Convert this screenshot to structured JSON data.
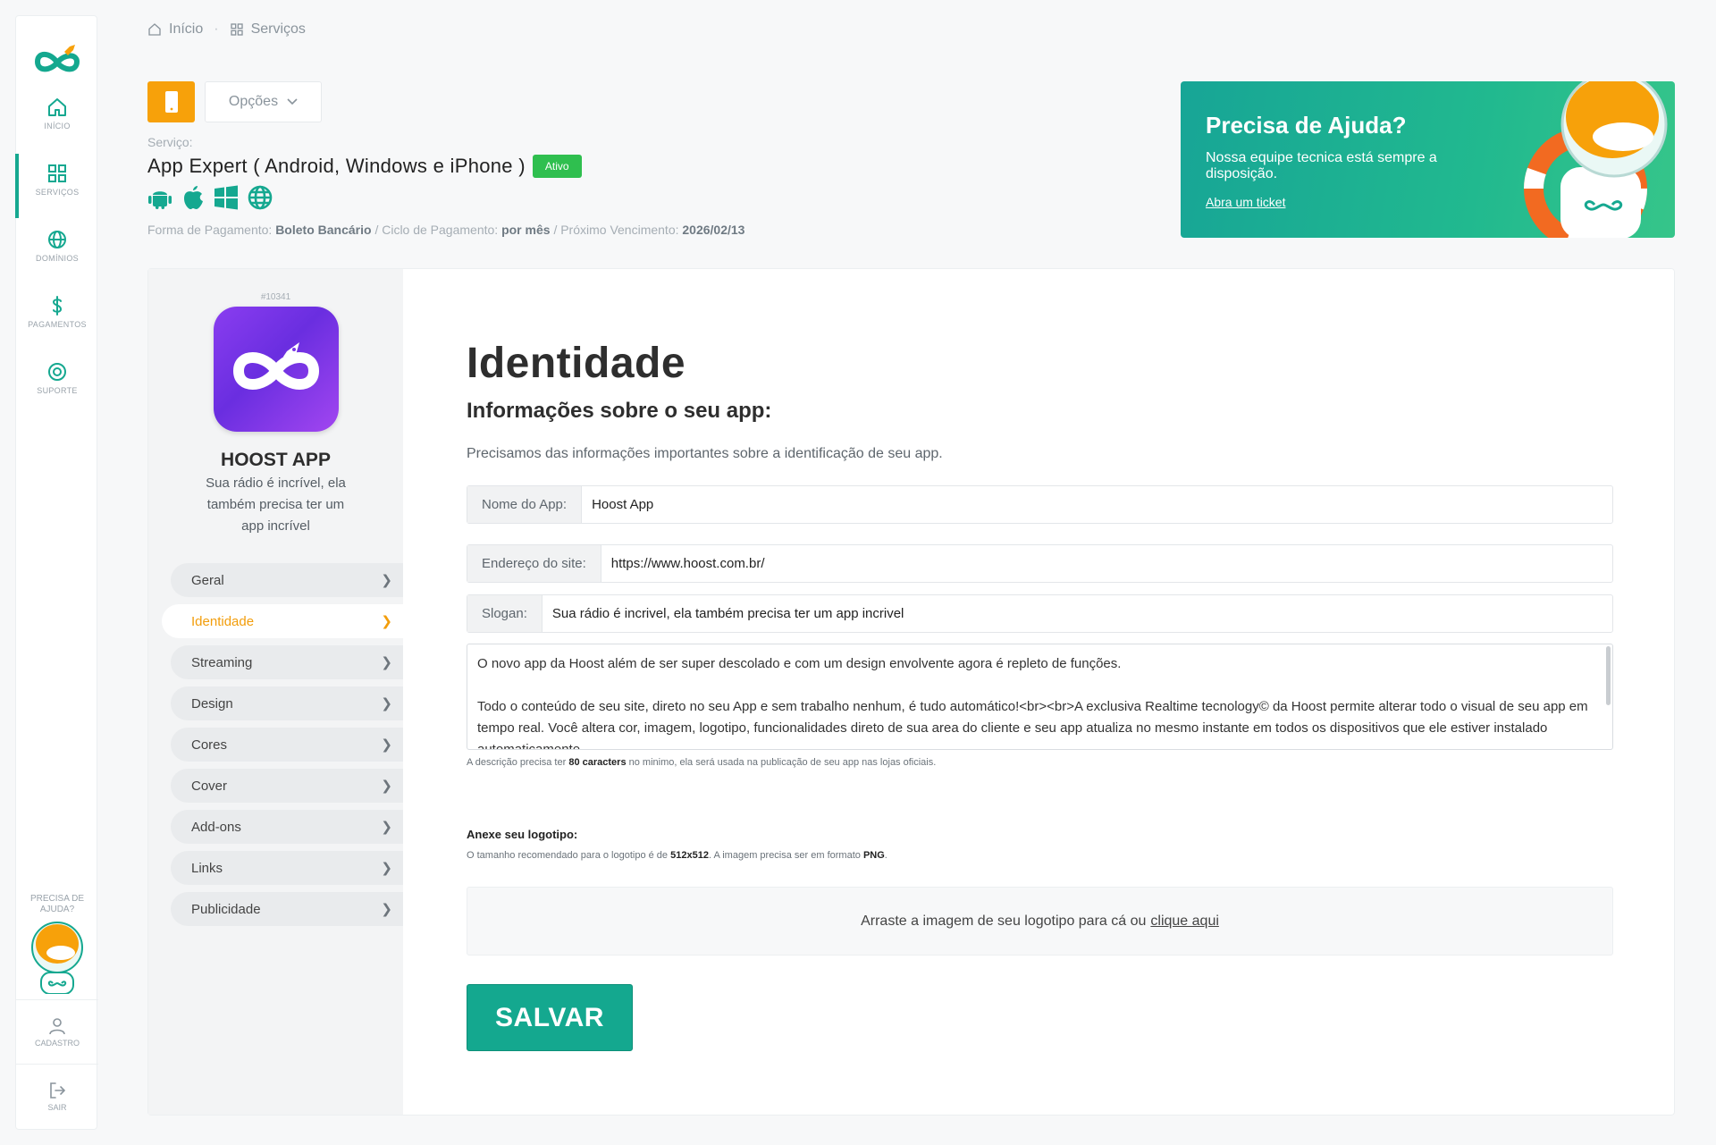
{
  "sidebar": {
    "items": [
      {
        "label": "Início",
        "icon": "home-icon"
      },
      {
        "label": "Serviços",
        "icon": "grid-icon"
      },
      {
        "label": "Domínios",
        "icon": "globe-icon"
      },
      {
        "label": "Pagamentos",
        "icon": "dollar-icon"
      },
      {
        "label": "Suporte",
        "icon": "lifebuoy-icon"
      }
    ],
    "help_label": "Precisa de ajuda?",
    "profile_label": "Cadastro",
    "logout_label": "Sair"
  },
  "breadcrumb": {
    "home": "Início",
    "current": "Serviços"
  },
  "header": {
    "options_label": "Opções",
    "service_label": "Serviço:",
    "service_title": "App Expert ( Android, Windows e iPhone )",
    "status": "Ativo",
    "platforms": [
      "android-icon",
      "apple-icon",
      "windows-icon",
      "globe-icon"
    ],
    "payment_method_label": "Forma de Pagamento:",
    "payment_method": "Boleto Bancário",
    "cycle_label": "/ Ciclo de Pagamento:",
    "cycle": "por mês",
    "due_label": "/ Próximo Vencimento:",
    "due": "2026/02/13"
  },
  "help_banner": {
    "title": "Precisa de Ajuda?",
    "text": "Nossa equipe tecnica está sempre a disposição.",
    "link": "Abra um ticket"
  },
  "app": {
    "id": "#10341",
    "name": "HOOST APP",
    "description": "Sua rádio é incrível, ela também precisa ter um app incrível"
  },
  "menu": [
    {
      "label": "Geral",
      "active": false
    },
    {
      "label": "Identidade",
      "active": true
    },
    {
      "label": "Streaming",
      "active": false
    },
    {
      "label": "Design",
      "active": false
    },
    {
      "label": "Cores",
      "active": false
    },
    {
      "label": "Cover",
      "active": false
    },
    {
      "label": "Add-ons",
      "active": false
    },
    {
      "label": "Links",
      "active": false
    },
    {
      "label": "Publicidade",
      "active": false
    }
  ],
  "form": {
    "title": "Identidade",
    "subtitle": "Informações sobre o seu app:",
    "intro": "Precisamos das informações importantes sobre a identificação de seu app.",
    "app_name_label": "Nome do App:",
    "app_name": "Hoost App",
    "site_label": "Endereço do site:",
    "site": "https://www.hoost.com.br/",
    "slogan_label": "Slogan:",
    "slogan": "Sua rádio é incrivel, ela também precisa ter um app incrivel",
    "description_p1": "O novo app da Hoost além de ser super descolado e com um design envolvente agora é repleto de funções.",
    "description_p2": "Todo o conteúdo de seu site, direto no seu App e sem trabalho nenhum, é tudo automático!<br><br>A exclusiva Realtime tecnology© da Hoost permite alterar todo o visual de seu app em tempo real. Você altera cor, imagem, logotipo, funcionalidades direto de sua area do cliente e seu app atualiza no mesmo instante em todos os dispositivos que ele estiver instalado automaticamente.",
    "hint_prefix": "A descrição precisa ter",
    "hint_bold": "80 caracters",
    "hint_suffix": "no minimo, ela será usada na publicação de seu app nas lojas oficiais.",
    "attach_title": "Anexe seu logotipo:",
    "attach_hint_prefix": "O tamanho recomendado para o logotipo é de",
    "attach_hint_size": "512x512",
    "attach_hint_mid": ". A imagem precisa ser em formato",
    "attach_hint_format": "PNG",
    "attach_hint_end": ".",
    "drop_text": "Arraste a imagem de seu logotipo para cá ou",
    "drop_link": "clique aqui",
    "save_label": "SALVAR"
  },
  "colors": {
    "brand": "#15a890",
    "accent": "#f7a10a",
    "status_active": "#2fbf4f"
  }
}
